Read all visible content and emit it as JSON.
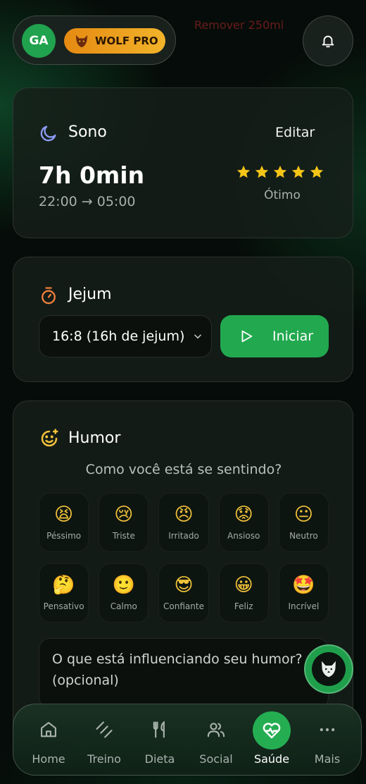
{
  "header": {
    "toast_text": "Remover 250ml",
    "avatar_initials": "GA",
    "plan_badge": "WOLF PRO"
  },
  "sleep": {
    "title": "Sono",
    "edit_label": "Editar",
    "duration": "7h 0min",
    "time_range": "22:00 → 05:00",
    "stars_filled": 5,
    "stars_total": 5,
    "rating_label": "Ótimo"
  },
  "fasting": {
    "title": "Jejum",
    "protocol": "16:8 (16h de jejum)",
    "start_label": "Iniciar"
  },
  "mood": {
    "title": "Humor",
    "question": "Como você está se sentindo?",
    "options": [
      {
        "emoji": "😫",
        "label": "Péssimo"
      },
      {
        "emoji": "😢",
        "label": "Triste"
      },
      {
        "emoji": "😠",
        "label": "Irritado"
      },
      {
        "emoji": "😟",
        "label": "Ansioso"
      },
      {
        "emoji": "😐",
        "label": "Neutro"
      },
      {
        "emoji": "🤔",
        "label": "Pensativo"
      },
      {
        "emoji": "🙂",
        "label": "Calmo"
      },
      {
        "emoji": "😎",
        "label": "Confiante"
      },
      {
        "emoji": "😀",
        "label": "Feliz"
      },
      {
        "emoji": "🤩",
        "label": "Incrível"
      }
    ],
    "note_placeholder": "O que está influenciando seu humor? (opcional)"
  },
  "nav": {
    "items": [
      {
        "label": "Home",
        "icon": "home-icon"
      },
      {
        "label": "Treino",
        "icon": "dumbbell-icon"
      },
      {
        "label": "Dieta",
        "icon": "fork-knife-icon"
      },
      {
        "label": "Social",
        "icon": "users-icon"
      },
      {
        "label": "Saúde",
        "icon": "heart-pulse-icon"
      },
      {
        "label": "Mais",
        "icon": "more-icon"
      }
    ],
    "active": "Saúde"
  },
  "colors": {
    "accent_green": "#22a94f",
    "badge_orange": "#f2a623",
    "star_yellow": "#f5c518",
    "timer_orange": "#f0803c",
    "moon_purple": "#8f9cf5"
  }
}
